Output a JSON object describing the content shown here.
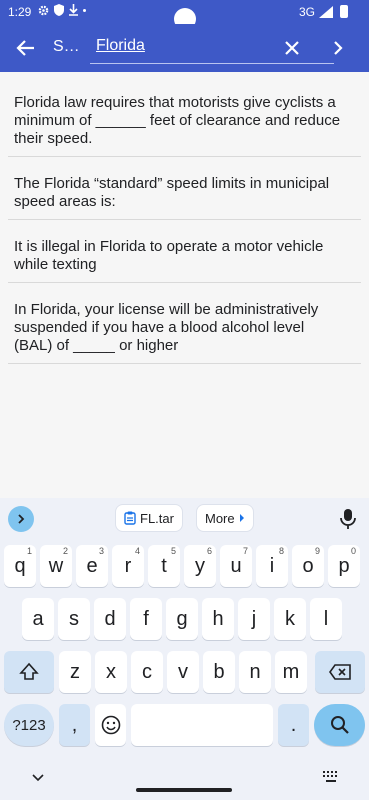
{
  "status_bar": {
    "time": "1:29",
    "network": "3G"
  },
  "app_bar": {
    "title": "S…",
    "search_value": "Florida"
  },
  "questions": [
    {
      "lines": [
        "Florida law requires that motorists give cyclists a",
        "minimum of ______ feet of clearance and reduce",
        "their speed."
      ]
    },
    {
      "lines": [
        "The Florida “standard” speed limits in municipal",
        "speed areas is:"
      ]
    },
    {
      "lines": [
        "It is illegal in Florida to operate a motor vehicle",
        "while texting"
      ]
    },
    {
      "lines": [
        "In Florida, your license will be administratively",
        "suspended if you have a blood alcohol level",
        "(BAL) of _____ or higher"
      ]
    }
  ],
  "keyboard": {
    "suggestion_chip": "FL.tar",
    "more_chip": "More",
    "row1": [
      {
        "k": "q",
        "h": "1"
      },
      {
        "k": "w",
        "h": "2"
      },
      {
        "k": "e",
        "h": "3"
      },
      {
        "k": "r",
        "h": "4"
      },
      {
        "k": "t",
        "h": "5"
      },
      {
        "k": "y",
        "h": "6"
      },
      {
        "k": "u",
        "h": "7"
      },
      {
        "k": "i",
        "h": "8"
      },
      {
        "k": "o",
        "h": "9"
      },
      {
        "k": "p",
        "h": "0"
      }
    ],
    "row2": [
      "a",
      "s",
      "d",
      "f",
      "g",
      "h",
      "j",
      "k",
      "l"
    ],
    "row3": [
      "z",
      "x",
      "c",
      "v",
      "b",
      "n",
      "m"
    ],
    "symbols_key": "?123",
    "comma_key": ",",
    "period_key": "."
  }
}
